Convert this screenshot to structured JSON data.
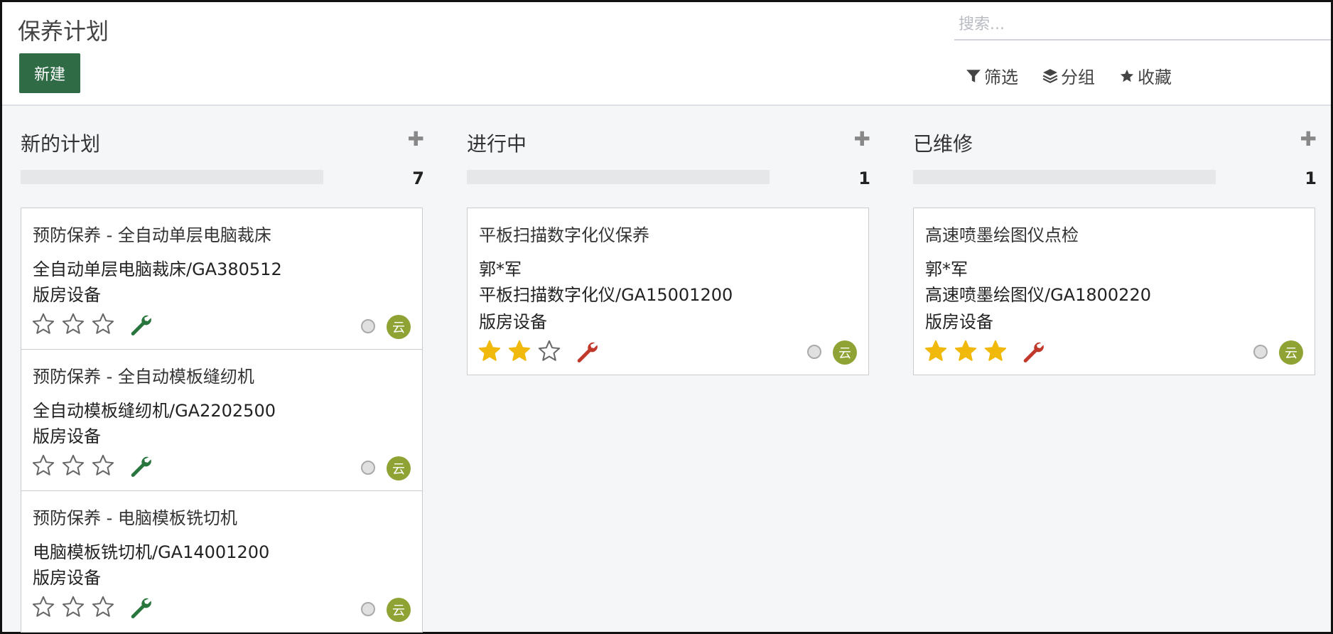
{
  "header": {
    "title": "保养计划",
    "new_label": "新建",
    "search_placeholder": "搜索...",
    "filter_label": "筛选",
    "group_label": "分组",
    "favorite_label": "收藏"
  },
  "columns": [
    {
      "title": "新的计划",
      "count": "7",
      "records": [
        {
          "title": "预防保养 - 全自动单层电脑裁床",
          "equipment": "全自动单层电脑裁床/GA380512",
          "category": "版房设备",
          "priority": 0,
          "avatar": "云"
        },
        {
          "title": "预防保养 - 全自动模板缝纫机",
          "equipment": "全自动模板缝纫机/GA2202500",
          "category": "版房设备",
          "priority": 0,
          "avatar": "云"
        },
        {
          "title": "预防保养 - 电脑模板铣切机",
          "equipment": "电脑模板铣切机/GA14001200",
          "category": "版房设备",
          "priority": 0,
          "avatar": "云"
        }
      ]
    },
    {
      "title": "进行中",
      "count": "1",
      "records": [
        {
          "title": "平板扫描数字化仪保养",
          "technician": "郭*军",
          "equipment": "平板扫描数字化仪/GA15001200",
          "category": "版房设备",
          "priority": 2,
          "avatar": "云"
        }
      ]
    },
    {
      "title": "已维修",
      "count": "1",
      "records": [
        {
          "title": "高速喷墨绘图仪点检",
          "technician": "郭*军",
          "equipment": "高速喷墨绘图仪/GA1800220",
          "category": "版房设备",
          "priority": 3,
          "avatar": "云"
        }
      ]
    }
  ],
  "colors": {
    "star_filled": "#f0b90b",
    "wrench_new": "#28763d",
    "wrench_other": "#c0392b",
    "primary_button": "#2f6b45",
    "avatar_bg": "#8fa234"
  },
  "icons": [
    "filter-icon",
    "layers-icon",
    "star-icon",
    "plus-icon",
    "wrench-icon"
  ]
}
